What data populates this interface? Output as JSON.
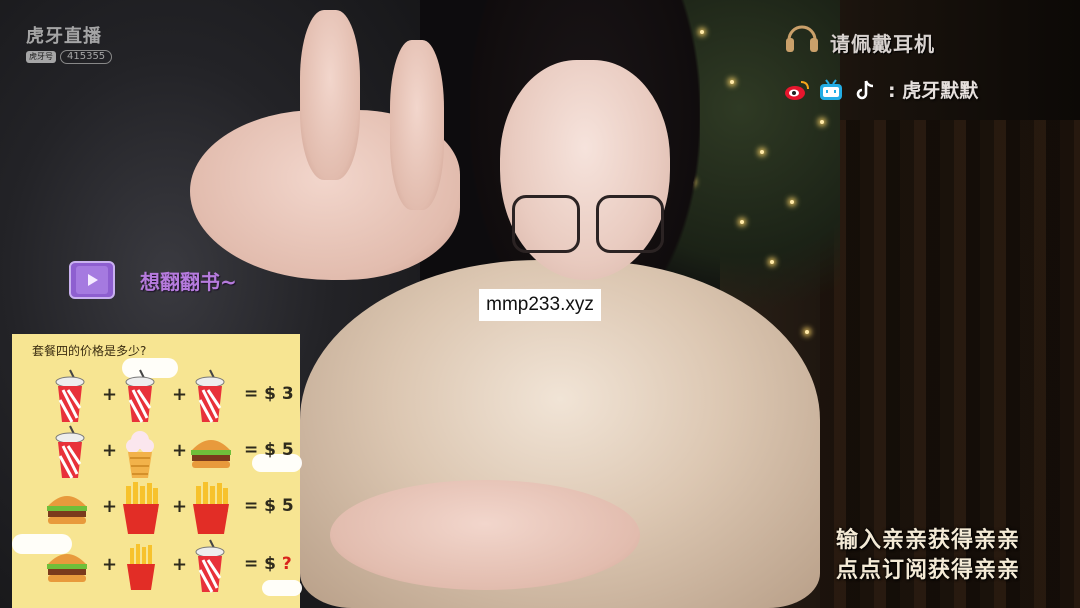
{
  "logo": {
    "brand": "虎牙直播",
    "badge": "虎牙号",
    "room_id": "415355"
  },
  "top_right": {
    "title": "请佩戴耳机",
    "social_name": ": 虎牙默默",
    "icons": [
      "weibo-icon",
      "bilibili-icon",
      "douyin-icon",
      "headphone-icon"
    ]
  },
  "chat_bubble": {
    "text": "想翻翻书~"
  },
  "watermark": {
    "text": "mmp233.xyz"
  },
  "puzzle": {
    "title": "套餐四的价格是多少?",
    "rows": [
      {
        "items": [
          "drink",
          "drink",
          "drink"
        ],
        "ops": [
          "+",
          "+"
        ],
        "result": "= $ 3"
      },
      {
        "items": [
          "drink",
          "icecream",
          "burger"
        ],
        "ops": [
          "+",
          "+"
        ],
        "result": "= $ 5"
      },
      {
        "items": [
          "burger",
          "fries",
          "fries"
        ],
        "ops": [
          "+",
          "+"
        ],
        "result": "= $ 5"
      },
      {
        "items": [
          "burger",
          "fries",
          "drink"
        ],
        "ops": [
          "+",
          "+"
        ],
        "result_prefix": "= $ ",
        "result_q": "?"
      }
    ]
  },
  "promo": {
    "line1": "输入亲亲获得亲亲",
    "line2": "点点订阅获得亲亲"
  },
  "colors": {
    "puzzle_bg": "#f7e592",
    "bubble_text": "#b67bdd",
    "question": "#d9241c"
  }
}
